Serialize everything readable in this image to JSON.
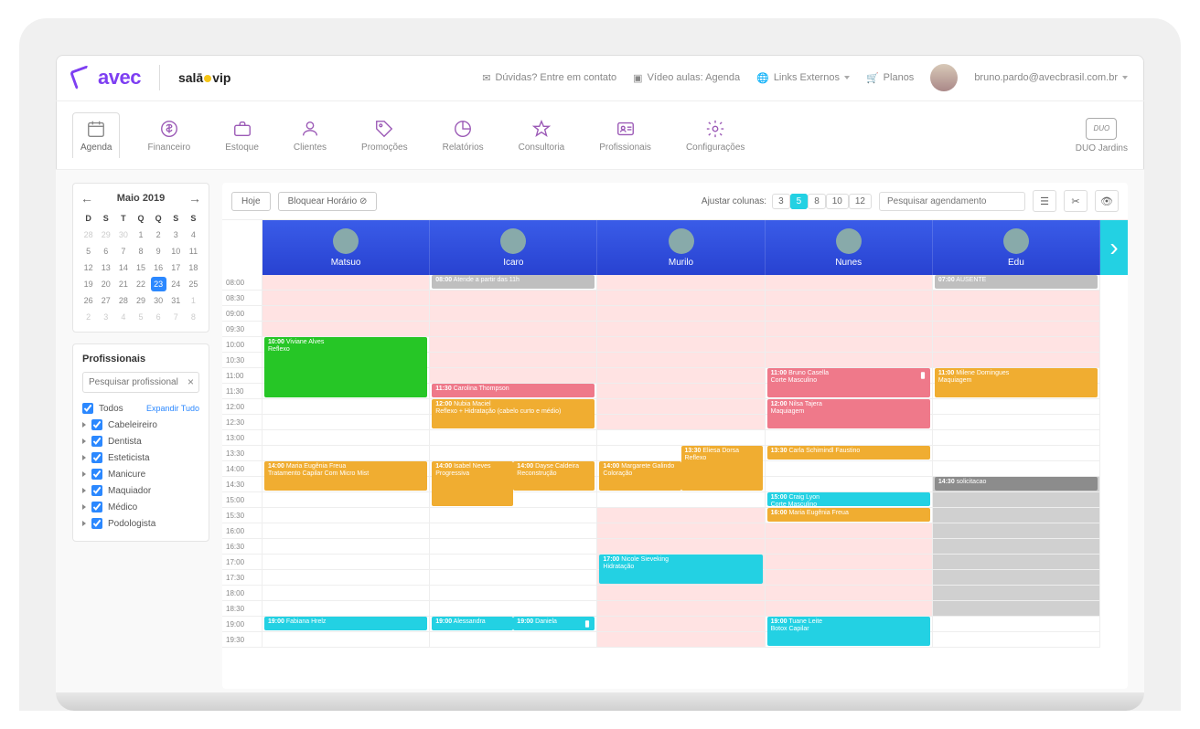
{
  "header": {
    "brand_avec": "avec",
    "brand_salao_prefix": "salā",
    "brand_salao_suffix": "vip",
    "duvidas": "Dúvidas? Entre em contato",
    "video_aulas": "Vídeo aulas: Agenda",
    "links_externos": "Links Externos",
    "planos": "Planos",
    "user_email": "bruno.pardo@avecbrasil.com.br"
  },
  "nav": {
    "agenda": "Agenda",
    "financeiro": "Financeiro",
    "estoque": "Estoque",
    "clientes": "Clientes",
    "promocoes": "Promoções",
    "relatorios": "Relatórios",
    "consultoria": "Consultoria",
    "profissionais": "Profissionais",
    "configuracoes": "Configurações"
  },
  "org": {
    "badge": "DUO",
    "name": "DUO Jardins"
  },
  "calendar": {
    "title": "Maio 2019",
    "days": [
      "D",
      "S",
      "T",
      "Q",
      "Q",
      "S",
      "S"
    ],
    "weeks": [
      [
        {
          "n": "28",
          "m": true
        },
        {
          "n": "29",
          "m": true
        },
        {
          "n": "30",
          "m": true
        },
        {
          "n": "1"
        },
        {
          "n": "2"
        },
        {
          "n": "3"
        },
        {
          "n": "4"
        }
      ],
      [
        {
          "n": "5"
        },
        {
          "n": "6"
        },
        {
          "n": "7"
        },
        {
          "n": "8"
        },
        {
          "n": "9"
        },
        {
          "n": "10"
        },
        {
          "n": "11"
        }
      ],
      [
        {
          "n": "12"
        },
        {
          "n": "13"
        },
        {
          "n": "14"
        },
        {
          "n": "15"
        },
        {
          "n": "16"
        },
        {
          "n": "17"
        },
        {
          "n": "18"
        }
      ],
      [
        {
          "n": "19"
        },
        {
          "n": "20"
        },
        {
          "n": "21"
        },
        {
          "n": "22"
        },
        {
          "n": "23",
          "sel": true
        },
        {
          "n": "24"
        },
        {
          "n": "25"
        }
      ],
      [
        {
          "n": "26"
        },
        {
          "n": "27"
        },
        {
          "n": "28"
        },
        {
          "n": "29"
        },
        {
          "n": "30"
        },
        {
          "n": "31"
        },
        {
          "n": "1",
          "m": true
        }
      ],
      [
        {
          "n": "2",
          "m": true
        },
        {
          "n": "3",
          "m": true
        },
        {
          "n": "4",
          "m": true
        },
        {
          "n": "5",
          "m": true
        },
        {
          "n": "6",
          "m": true
        },
        {
          "n": "7",
          "m": true
        },
        {
          "n": "8",
          "m": true
        }
      ]
    ]
  },
  "professionals_panel": {
    "title": "Profissionais",
    "search_placeholder": "Pesquisar profissional",
    "clear": "×",
    "all": "Todos",
    "expand_all": "Expandir Tudo",
    "categories": [
      "Cabeleireiro",
      "Dentista",
      "Esteticista",
      "Manicure",
      "Maquiador",
      "Médico",
      "Podologista"
    ]
  },
  "agenda_bar": {
    "today": "Hoje",
    "block": "Bloquear Horário ⊘",
    "adjust": "Ajustar colunas:",
    "options": [
      "3",
      "5",
      "8",
      "10",
      "12"
    ],
    "active": "5",
    "search_placeholder": "Pesquisar agendamento"
  },
  "time_slots": [
    "08:00",
    "08:30",
    "09:00",
    "09:30",
    "10:00",
    "10:30",
    "11:00",
    "11:30",
    "12:00",
    "12:30",
    "13:00",
    "13:30",
    "14:00",
    "14:30",
    "15:00",
    "15:30",
    "16:00",
    "16:30",
    "17:00",
    "17:30",
    "18:00",
    "18:30",
    "19:00",
    "19:30"
  ],
  "professionals": [
    {
      "name": "Matsuo",
      "unavailable": [
        0,
        1,
        2,
        3
      ],
      "split": false,
      "events": [
        {
          "start": 4,
          "span": 4,
          "class": "c-green",
          "time": "10:00",
          "title": "Viviane Alves",
          "sub": "Reflexo"
        },
        {
          "start": 12,
          "span": 2,
          "class": "c-orange",
          "time": "14:00",
          "title": "Maria Eugênia Freua",
          "sub": "Tratamento Capilar Com Micro Mist"
        },
        {
          "start": 22,
          "span": 1,
          "class": "c-cyan",
          "time": "19:00",
          "title": "Fabiana Hrelz",
          "sub": ""
        }
      ]
    },
    {
      "name": "Icaro",
      "unavailable": [
        1,
        2,
        3,
        4,
        5,
        6
      ],
      "split": true,
      "events": [
        {
          "start": 0,
          "span": 1,
          "class": "c-gray",
          "full": true,
          "time": "08:00",
          "title": "Atende a partir das 11h",
          "sub": ""
        },
        {
          "start": 7,
          "span": 1,
          "class": "c-pink",
          "time": "11:30",
          "title": "Carolina Thompson",
          "sub": ""
        },
        {
          "start": 8,
          "span": 2,
          "class": "c-orange",
          "time": "12:00",
          "title": "Nubia Maciel",
          "sub": "Reflexo + Hidratação (cabelo curto e médio)"
        },
        {
          "start": 12,
          "span": 3,
          "class": "c-orange",
          "half": "left",
          "time": "14:00",
          "title": "Isabel Neves",
          "sub": "Progressiva"
        },
        {
          "start": 12,
          "span": 2,
          "class": "c-orange",
          "half": "right",
          "time": "14:00",
          "title": "Dayse Caldeira",
          "sub": "Reconstrução"
        },
        {
          "start": 22,
          "span": 1,
          "class": "c-cyan",
          "half": "left",
          "time": "19:00",
          "title": "Alessandra",
          "sub": ""
        },
        {
          "start": 22,
          "span": 1,
          "class": "c-cyan",
          "half": "right",
          "time": "19:00",
          "title": "Daniela",
          "sub": "",
          "phone": true
        }
      ]
    },
    {
      "name": "Murilo",
      "unavailable": [
        0,
        1,
        2,
        3,
        4,
        5,
        6,
        7,
        8,
        9,
        15,
        16,
        17,
        18,
        19,
        20,
        21,
        22,
        23
      ],
      "split": true,
      "events": [
        {
          "start": 11,
          "span": 3,
          "class": "c-orange",
          "half": "right",
          "time": "13:30",
          "title": "Eliesa Dorsa",
          "sub": "Reflexo"
        },
        {
          "start": 12,
          "span": 2,
          "class": "c-orange",
          "half": "left",
          "time": "14:00",
          "title": "Margarete Galindo",
          "sub": "Coloração"
        },
        {
          "start": 18,
          "span": 2,
          "class": "c-cyan",
          "time": "17:00",
          "title": "Nicole Sieveking",
          "sub": "Hidratação"
        }
      ]
    },
    {
      "name": "Nunes",
      "unavailable": [
        0,
        1,
        2,
        3,
        4,
        5,
        16,
        17,
        18,
        19,
        20,
        21
      ],
      "split": false,
      "events": [
        {
          "start": 6,
          "span": 2,
          "class": "c-pink",
          "time": "11:00",
          "title": "Bruno Casella",
          "sub": "Corte Masculino",
          "phone": true
        },
        {
          "start": 8,
          "span": 2,
          "class": "c-pink",
          "time": "12:00",
          "title": "Nilsa Tajera",
          "sub": "Maquiagem"
        },
        {
          "start": 11,
          "span": 1,
          "class": "c-orange",
          "time": "13:30",
          "title": "Carla Schimindl Faustino",
          "sub": ""
        },
        {
          "start": 14,
          "span": 1,
          "class": "c-cyan",
          "time": "15:00",
          "title": "Craig Lyon",
          "sub": "Corte Masculino"
        },
        {
          "start": 15,
          "span": 1,
          "class": "c-orange",
          "time": "16:00",
          "title": "Maria Eugênia Freua",
          "sub": ""
        },
        {
          "start": 22,
          "span": 2,
          "class": "c-cyan",
          "time": "19:00",
          "title": "Tuane Leite",
          "sub": "Botox Capilar"
        }
      ]
    },
    {
      "name": "Edu",
      "unavailable": [
        1,
        2,
        3,
        4,
        5
      ],
      "darkslots": [
        13,
        14,
        15,
        16,
        17,
        18,
        19,
        20,
        21
      ],
      "split": false,
      "events": [
        {
          "start": 0,
          "span": 1,
          "class": "c-gray",
          "time": "07:00",
          "title": "AUSENTE",
          "sub": ""
        },
        {
          "start": 6,
          "span": 2,
          "class": "c-orange",
          "time": "11:00",
          "title": "Milene Domingues",
          "sub": "Maquiagem"
        },
        {
          "start": 13,
          "span": 1,
          "class": "c-darkgray",
          "time": "14:30",
          "title": "solicitacao",
          "sub": ""
        }
      ]
    }
  ]
}
